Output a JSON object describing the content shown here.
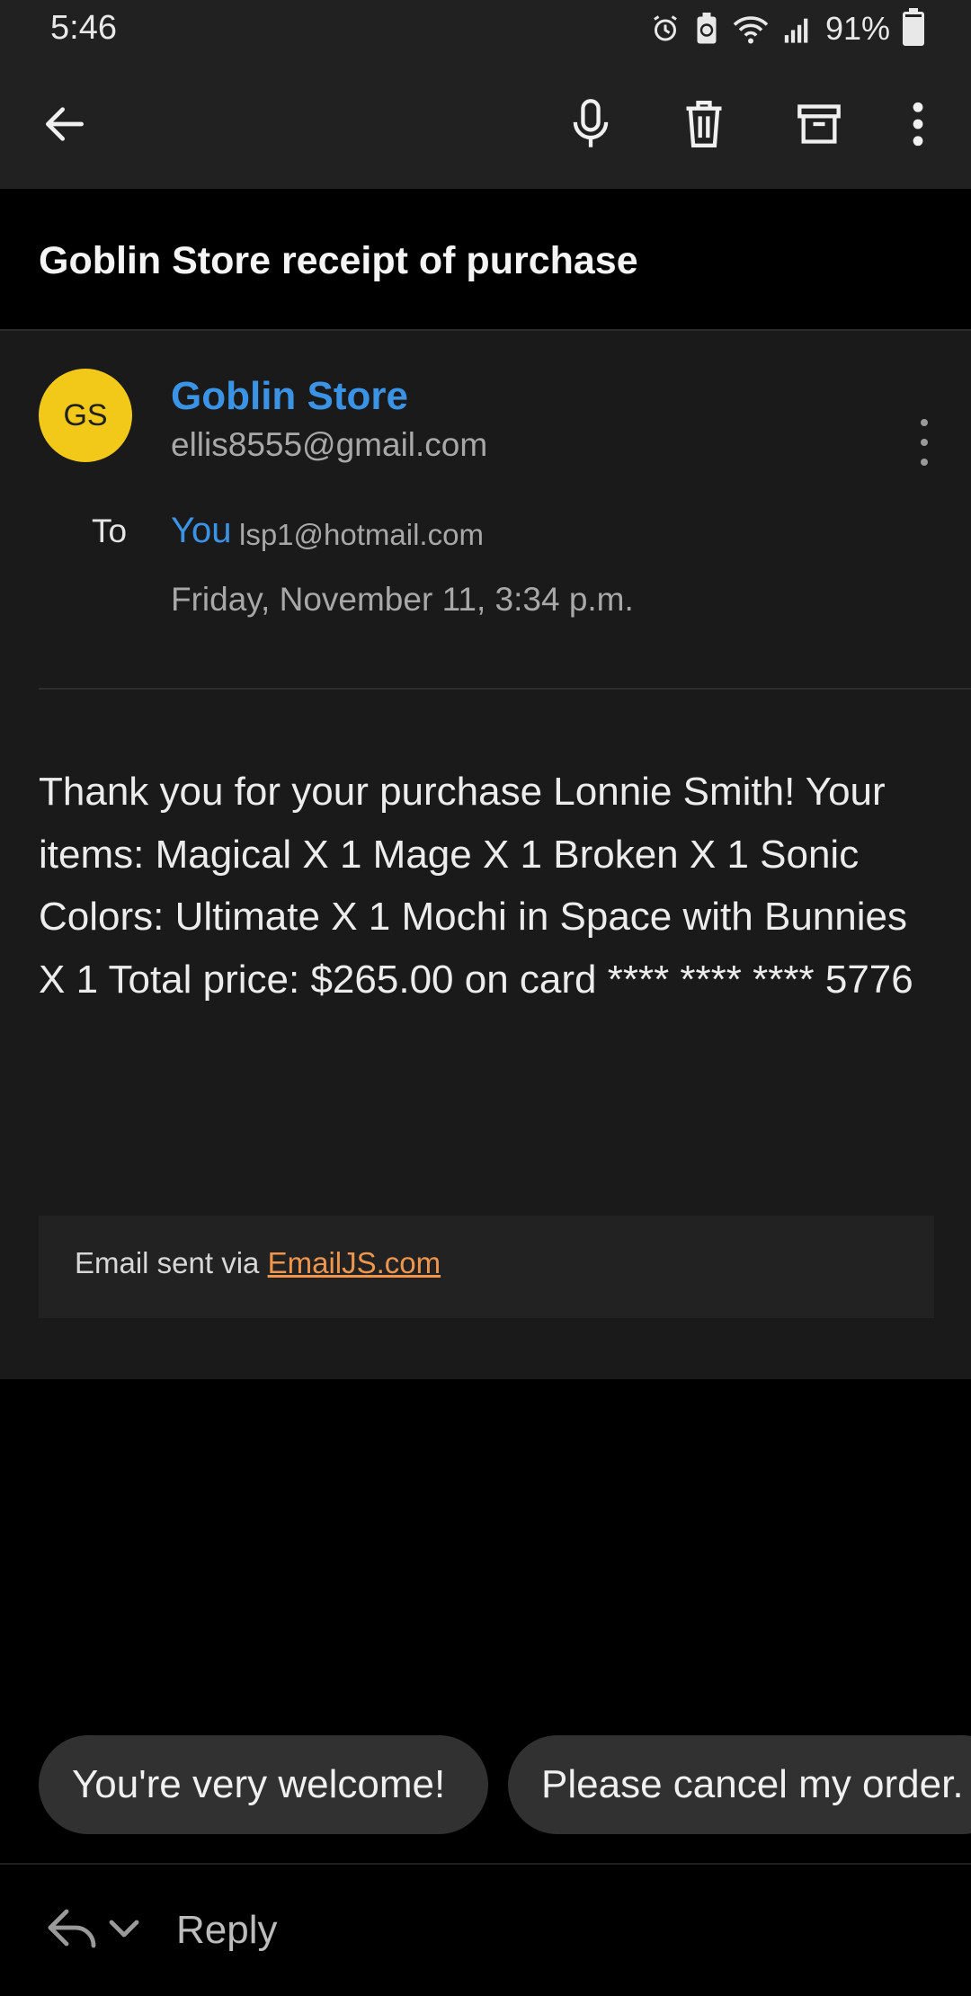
{
  "status_bar": {
    "time": "5:46",
    "battery_percent": "91%",
    "battery_level": 0.91
  },
  "app_bar": {
    "icons": [
      "back-arrow-icon",
      "microphone-icon",
      "trash-icon",
      "archive-icon",
      "more-vert-icon"
    ]
  },
  "email": {
    "subject": "Goblin Store receipt of purchase",
    "sender": {
      "initials": "GS",
      "name": "Goblin Store",
      "email": "ellis8555@gmail.com",
      "avatar_color": "#f2c919"
    },
    "to_label": "To",
    "recipient_name": "You",
    "recipient_email": "lsp1@hotmail.com",
    "date": "Friday, November 11, 3:34 p.m.",
    "body": "Thank you for your purchase Lonnie Smith! Your items: Magical X 1 Mage X 1 Broken X 1 Sonic Colors: Ultimate X 1 Mochi in Space with Bunnies X 1 Total price: $265.00 on card **** **** **** 5776",
    "footer_prefix": "Email sent via ",
    "footer_link": "EmailJS.com"
  },
  "smart_replies": [
    "You're very welcome!",
    "Please cancel my order."
  ],
  "reply_bar": {
    "label": "Reply"
  },
  "colors": {
    "link_blue": "#3b93e6",
    "link_orange": "#f0964c",
    "background": "#000000",
    "card": "#1a1a1a"
  }
}
